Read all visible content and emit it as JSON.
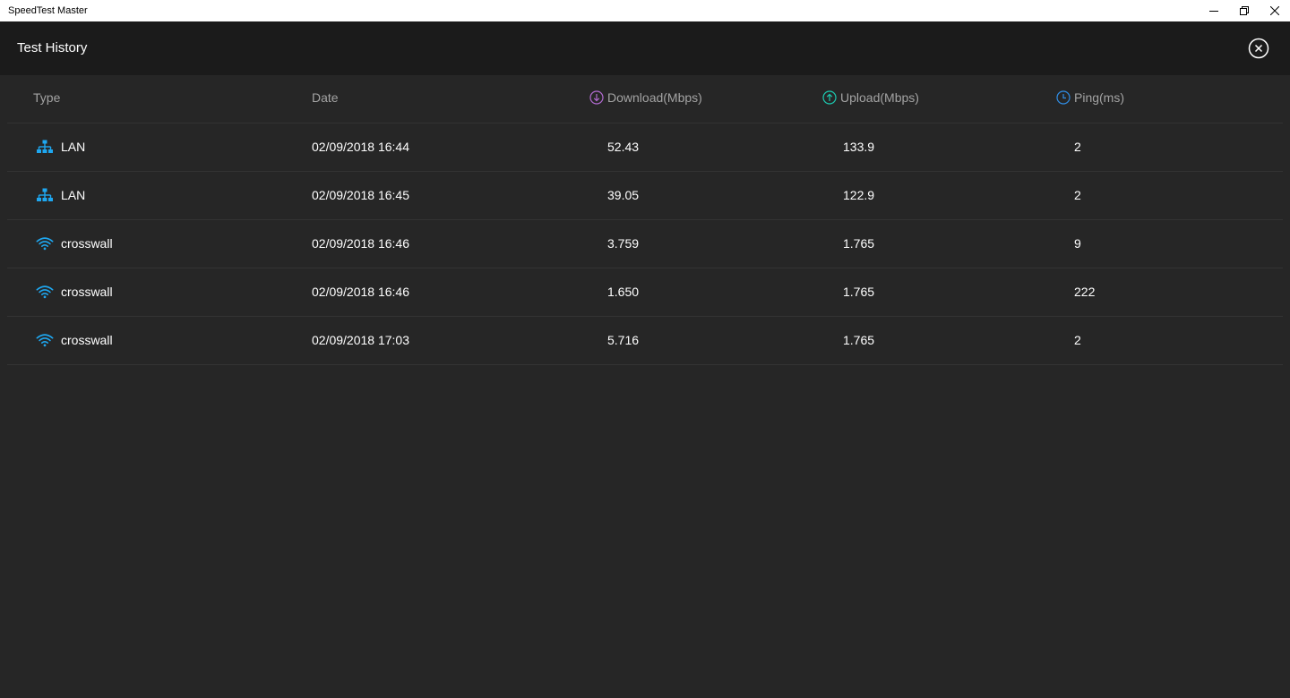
{
  "window": {
    "title": "SpeedTest Master"
  },
  "header": {
    "title": "Test History"
  },
  "icons": {
    "lan": "network-icon",
    "wifi": "wifi-icon"
  },
  "colors": {
    "download": "#b26bd1",
    "upload": "#1cc9b0",
    "ping": "#2f8ee6",
    "type_icon": "#1ea7f0"
  },
  "table": {
    "columns": [
      "Type",
      "Date",
      "Download(Mbps)",
      "Upload(Mbps)",
      "Ping(ms)"
    ],
    "rows": [
      {
        "icon": "lan",
        "type": "LAN",
        "date": "02/09/2018 16:44",
        "download": "52.43",
        "upload": "133.9",
        "ping": "2"
      },
      {
        "icon": "lan",
        "type": "LAN",
        "date": "02/09/2018 16:45",
        "download": "39.05",
        "upload": "122.9",
        "ping": "2"
      },
      {
        "icon": "wifi",
        "type": "crosswall",
        "date": "02/09/2018 16:46",
        "download": "3.759",
        "upload": "1.765",
        "ping": "9"
      },
      {
        "icon": "wifi",
        "type": "crosswall",
        "date": "02/09/2018 16:46",
        "download": "1.650",
        "upload": "1.765",
        "ping": "222"
      },
      {
        "icon": "wifi",
        "type": "crosswall",
        "date": "02/09/2018 17:03",
        "download": "5.716",
        "upload": "1.765",
        "ping": "2"
      }
    ]
  }
}
